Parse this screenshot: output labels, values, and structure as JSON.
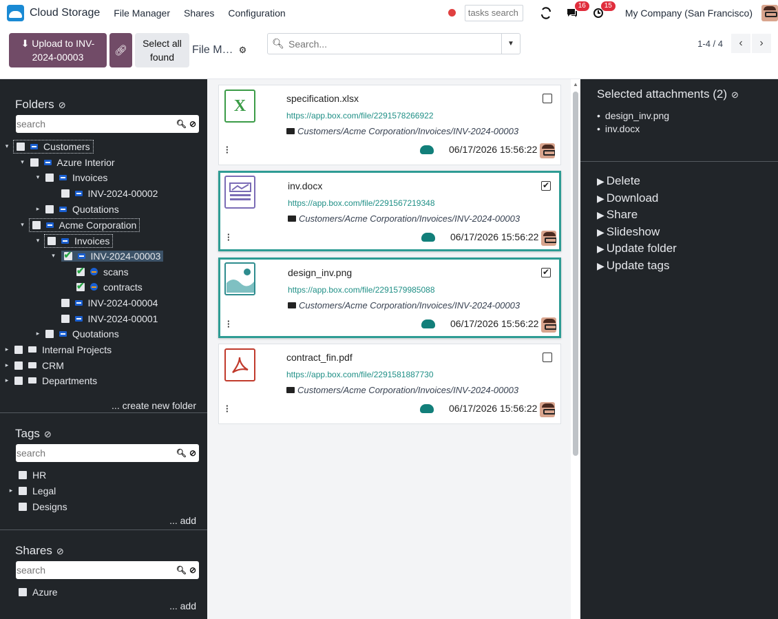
{
  "navbar": {
    "brand": "Cloud Storage",
    "menu": [
      "File Manager",
      "Shares",
      "Configuration"
    ],
    "tasks_placeholder": "tasks search",
    "messages_count": "16",
    "activities_count": "15",
    "company": "My Company (San Francisco)"
  },
  "control": {
    "upload_label": "Upload to INV-2024-00003",
    "select_all_label": "Select all found",
    "breadcrumb": "File M…",
    "search_placeholder": "Search...",
    "pager": "1-4 / 4"
  },
  "folders": {
    "title": "Folders",
    "search_placeholder": "search",
    "create_label": "... create new folder",
    "tree": [
      {
        "label": "Customers",
        "caret": "▾",
        "icon": "dropbox"
      },
      {
        "label": "Azure Interior",
        "caret": "▾",
        "icon": "dropbox"
      },
      {
        "label": "Invoices",
        "caret": "▾",
        "icon": "dropbox"
      },
      {
        "label": "INV-2024-00002",
        "caret": "",
        "icon": "dropbox"
      },
      {
        "label": "Quotations",
        "caret": "▸",
        "icon": "dropbox"
      },
      {
        "label": "Acme Corporation",
        "caret": "▾",
        "icon": "dropbox"
      },
      {
        "label": "Invoices",
        "caret": "▾",
        "icon": "dropbox"
      },
      {
        "label": "INV-2024-00003",
        "caret": "▾",
        "icon": "dropbox"
      },
      {
        "label": "scans",
        "caret": "",
        "icon": "shared"
      },
      {
        "label": "contracts",
        "caret": "",
        "icon": "shared"
      },
      {
        "label": "INV-2024-00004",
        "caret": "",
        "icon": "dropbox"
      },
      {
        "label": "INV-2024-00001",
        "caret": "",
        "icon": "dropbox"
      },
      {
        "label": "Quotations",
        "caret": "▸",
        "icon": "dropbox"
      },
      {
        "label": "Internal Projects",
        "caret": "▸",
        "icon": "folder"
      },
      {
        "label": "CRM",
        "caret": "▸",
        "icon": "folder"
      },
      {
        "label": "Departments",
        "caret": "▸",
        "icon": "folder"
      }
    ]
  },
  "tags": {
    "title": "Tags",
    "search_placeholder": "search",
    "items": [
      "HR",
      "Legal",
      "Designs"
    ],
    "add_label": "... add"
  },
  "shares": {
    "title": "Shares",
    "search_placeholder": "search",
    "items": [
      "Azure"
    ],
    "add_label": "... add"
  },
  "files": [
    {
      "name": "specification.xlsx",
      "url": "https://app.box.com/file/2291578266922",
      "path": "Customers/Acme Corporation/Invoices/INV-2024-00003",
      "date": "06/17/2026 15:56:22",
      "type": "xlsx",
      "selected": false
    },
    {
      "name": "inv.docx",
      "url": "https://app.box.com/file/2291567219348",
      "path": "Customers/Acme Corporation/Invoices/INV-2024-00003",
      "date": "06/17/2026 15:56:22",
      "type": "docx",
      "selected": true
    },
    {
      "name": "design_inv.png",
      "url": "https://app.box.com/file/2291579985088",
      "path": "Customers/Acme Corporation/Invoices/INV-2024-00003",
      "date": "06/17/2026 15:56:22",
      "type": "png",
      "selected": true
    },
    {
      "name": "contract_fin.pdf",
      "url": "https://app.box.com/file/2291581887730",
      "path": "Customers/Acme Corporation/Invoices/INV-2024-00003",
      "date": "06/17/2026 15:56:22",
      "type": "pdf",
      "selected": false
    }
  ],
  "selection": {
    "title": "Selected attachments (2)",
    "items": [
      "design_inv.png",
      "inv.docx"
    ],
    "actions": [
      "Delete",
      "Download",
      "Share",
      "Slideshow",
      "Update folder",
      "Update tags"
    ]
  },
  "colors": {
    "primary": "#714b67",
    "panel_dark": "#212529",
    "selected_border": "#2e9c94",
    "link": "#1f8f86",
    "badge": "#e02d3c"
  }
}
